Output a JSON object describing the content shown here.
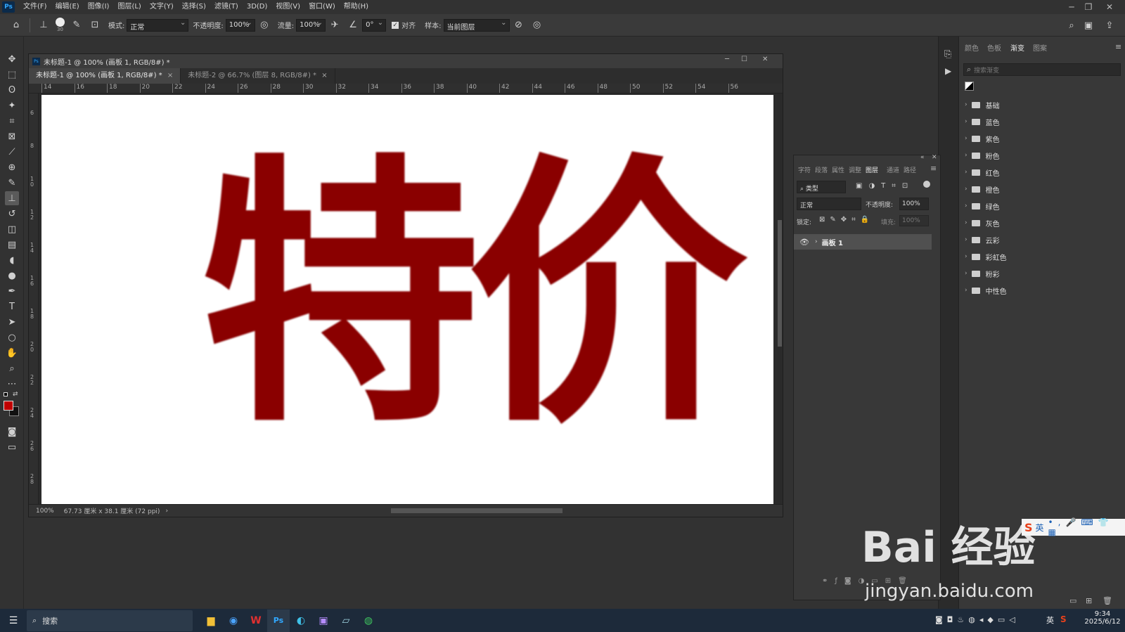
{
  "menubar": {
    "logo": "Ps",
    "items": [
      "文件(F)",
      "编辑(E)",
      "图像(I)",
      "图层(L)",
      "文字(Y)",
      "选择(S)",
      "滤镜(T)",
      "3D(D)",
      "视图(V)",
      "窗口(W)",
      "帮助(H)"
    ]
  },
  "options": {
    "brush_size": "30",
    "mode_label": "模式:",
    "mode_value": "正常",
    "opacity_label": "不透明度:",
    "opacity_value": "100%",
    "flow_label": "流量:",
    "flow_value": "100%",
    "angle_value": "0°",
    "align_label": "对齐",
    "sample_label": "样本:",
    "sample_value": "当前图层"
  },
  "document": {
    "title": "未标题-1 @ 100% (画板 1, RGB/8#) *",
    "tabs": [
      "未标题-1 @ 100% (画板 1, RGB/8#) *",
      "未标题-2 @ 66.7% (图层 8, RGB/8#) *"
    ],
    "ruler_top": [
      "14",
      "16",
      "18",
      "20",
      "22",
      "24",
      "26",
      "28",
      "30",
      "32",
      "34",
      "36",
      "38",
      "40",
      "42",
      "44",
      "46",
      "48",
      "50",
      "52",
      "54",
      "56"
    ],
    "ruler_left": [
      "6",
      "8",
      "1 0",
      "1 2",
      "1 4",
      "1 6",
      "1 8",
      "2 0",
      "2 2",
      "2 4",
      "2 6",
      "2 8"
    ],
    "canvas_text": "特价",
    "status_zoom": "100%",
    "status_info": "67.73 厘米 x 38.1 厘米 (72 ppi)"
  },
  "gradients": {
    "tabs": [
      "颜色",
      "色板",
      "渐变",
      "图案"
    ],
    "search_placeholder": "搜索渐变",
    "folders": [
      "基础",
      "蓝色",
      "紫色",
      "粉色",
      "红色",
      "橙色",
      "绿色",
      "灰色",
      "云彩",
      "彩虹色",
      "粉彩",
      "中性色"
    ]
  },
  "layers": {
    "tabs": [
      "字符",
      "段落",
      "属性",
      "调整",
      "图层",
      "通道",
      "路径"
    ],
    "filter_label": "类型",
    "blend_value": "正常",
    "opacity_label": "不透明度:",
    "opacity_value": "100%",
    "lock_label": "锁定:",
    "fill_label": "填充:",
    "fill_value": "100%",
    "layer_name": "画板 1"
  },
  "taskbar": {
    "search_label": "搜索",
    "time": "9:34",
    "date": "2025/6/12",
    "lang": "英"
  },
  "watermark": {
    "main": "Bai 经验",
    "url": "jingyan.baidu.com"
  },
  "ime": {
    "lang": "英"
  },
  "colors": {
    "foreground": "#c00000",
    "text_red": "#8a0000"
  }
}
